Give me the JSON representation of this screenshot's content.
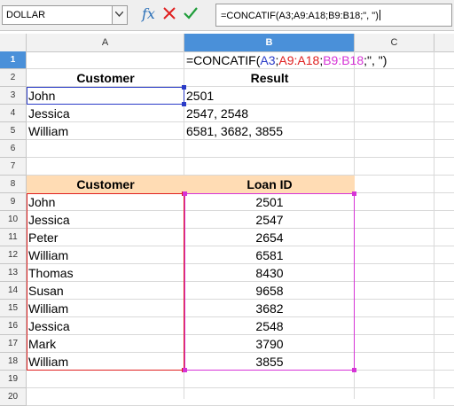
{
  "namebox": {
    "value": "DOLLAR"
  },
  "formula_bar": {
    "fx_label": "fx",
    "formula": "=CONCATIF(A3;A9:A18;B9:B18;\", \")"
  },
  "columns": [
    "A",
    "B",
    "C"
  ],
  "rows": [
    "1",
    "2",
    "3",
    "4",
    "5",
    "6",
    "7",
    "8",
    "9",
    "10",
    "11",
    "12",
    "13",
    "14",
    "15",
    "16",
    "17",
    "18",
    "19",
    "20"
  ],
  "b1_formula_parts": {
    "p1": "=CONCATIF(",
    "p2": "A3",
    "p3": ";",
    "p4": "A9:A18",
    "p5": ";",
    "p6": "B9:B18",
    "p7": ";\", \")"
  },
  "result_table": {
    "header_customer": "Customer",
    "header_result": "Result",
    "rows": [
      {
        "customer": "John",
        "result": "2501"
      },
      {
        "customer": "Jessica",
        "result": "2547, 2548"
      },
      {
        "customer": "William",
        "result": "6581, 3682, 3855"
      }
    ]
  },
  "loan_table": {
    "header_customer": "Customer",
    "header_loan": "Loan ID",
    "rows": [
      {
        "customer": "John",
        "loan": "2501"
      },
      {
        "customer": "Jessica",
        "loan": "2547"
      },
      {
        "customer": "Peter",
        "loan": "2654"
      },
      {
        "customer": "William",
        "loan": "6581"
      },
      {
        "customer": "Thomas",
        "loan": "8430"
      },
      {
        "customer": "Susan",
        "loan": "9658"
      },
      {
        "customer": "William",
        "loan": "3682"
      },
      {
        "customer": "Jessica",
        "loan": "2548"
      },
      {
        "customer": "Mark",
        "loan": "3790"
      },
      {
        "customer": "William",
        "loan": "3855"
      }
    ]
  },
  "colors": {
    "header_fill": "#ffdcb4",
    "ref_blue": "#2a3bc7",
    "ref_red": "#e02020",
    "ref_magenta": "#d633d6",
    "active_header": "#4a90d9"
  },
  "icons": {
    "dropdown": "chevron-down-icon",
    "function_wizard": "fx-icon",
    "cancel": "cancel-icon",
    "accept": "accept-icon"
  }
}
